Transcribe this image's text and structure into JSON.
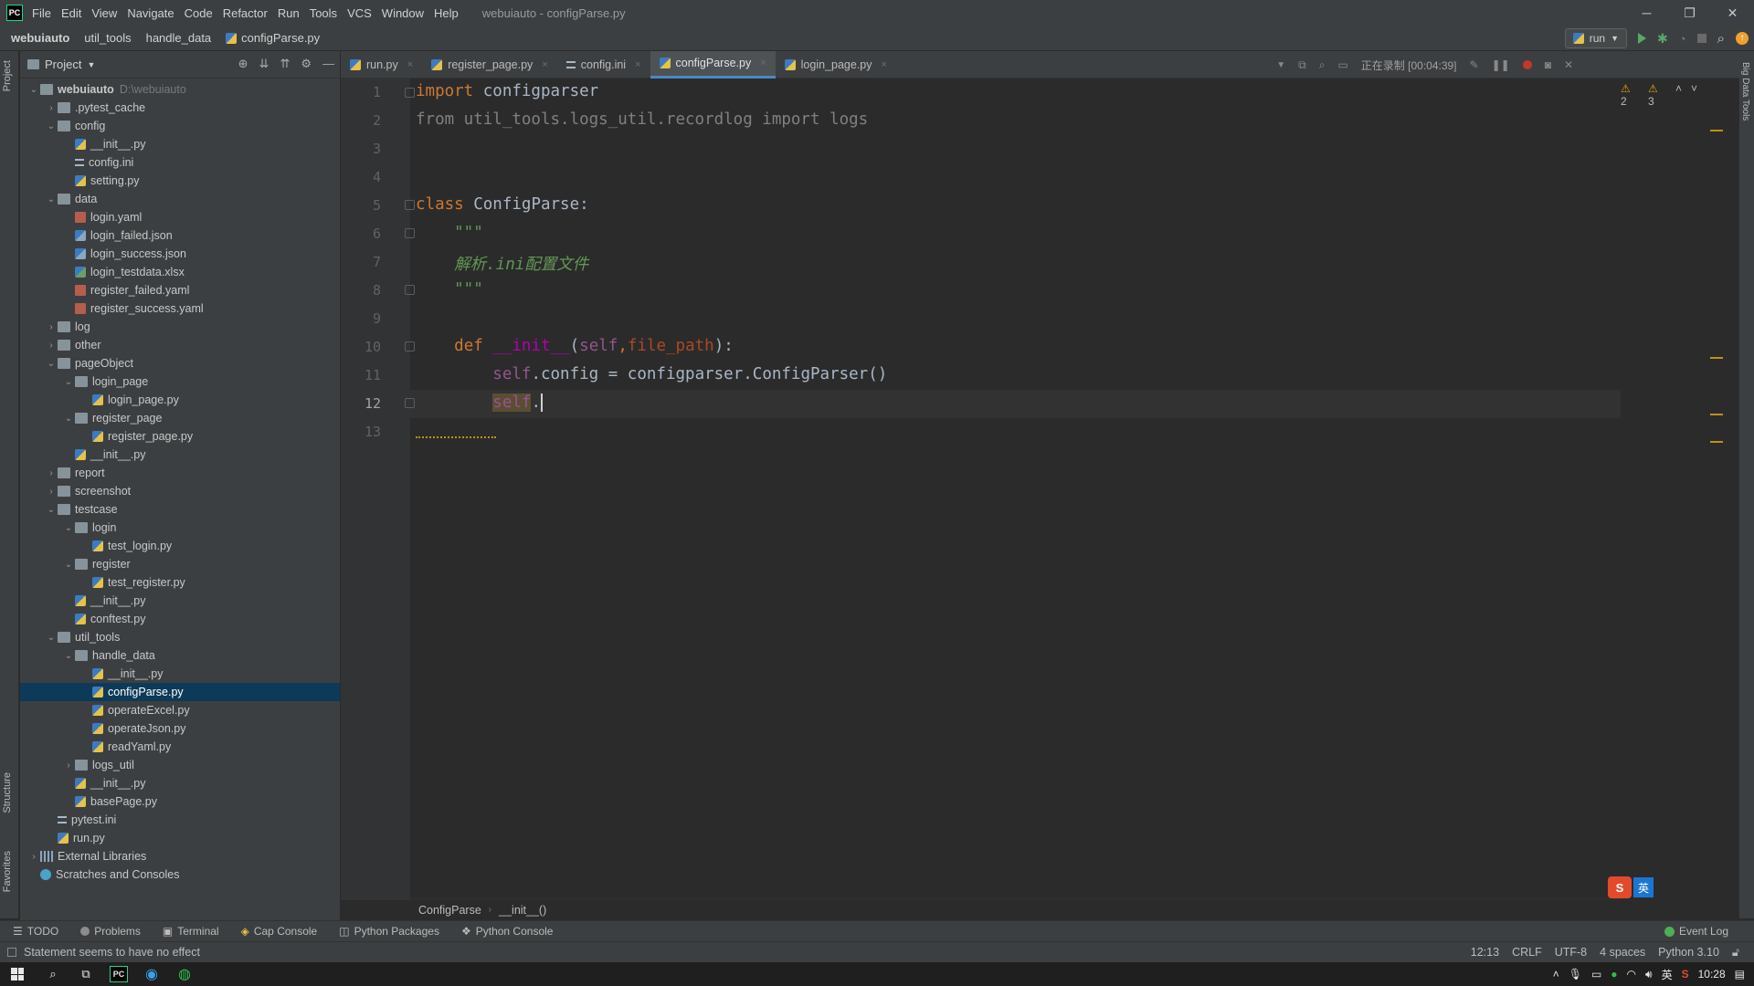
{
  "app": {
    "logo": "PC",
    "window_title": "webuiauto - configParse.py",
    "menu": [
      "File",
      "Edit",
      "View",
      "Navigate",
      "Code",
      "Refactor",
      "Run",
      "Tools",
      "VCS",
      "Window",
      "Help"
    ],
    "window_controls": [
      "─",
      "❐",
      "✕"
    ]
  },
  "navbar": {
    "crumbs": [
      "webuiauto",
      "util_tools",
      "handle_data",
      "configParse.py"
    ],
    "run_config": "run"
  },
  "left_strip": {
    "project": "Project",
    "structure": "Structure",
    "favorites": "Favorites"
  },
  "right_strip": {
    "bigdata": "Big Data Tools"
  },
  "project_panel": {
    "title": "Project",
    "tree": [
      {
        "label": "webuiauto",
        "hint": "D:\\webuiauto",
        "level": 0,
        "type": "folder",
        "open": true,
        "bold": true
      },
      {
        "label": ".pytest_cache",
        "level": 1,
        "type": "folder",
        "open": false
      },
      {
        "label": "config",
        "level": 1,
        "type": "folder",
        "open": true
      },
      {
        "label": "__init__.py",
        "level": 2,
        "type": "py"
      },
      {
        "label": "config.ini",
        "level": 2,
        "type": "ini"
      },
      {
        "label": "setting.py",
        "level": 2,
        "type": "py"
      },
      {
        "label": "data",
        "level": 1,
        "type": "folder",
        "open": true
      },
      {
        "label": "login.yaml",
        "level": 2,
        "type": "yaml"
      },
      {
        "label": "login_failed.json",
        "level": 2,
        "type": "json"
      },
      {
        "label": "login_success.json",
        "level": 2,
        "type": "json"
      },
      {
        "label": "login_testdata.xlsx",
        "level": 2,
        "type": "xlsx"
      },
      {
        "label": "register_failed.yaml",
        "level": 2,
        "type": "yaml"
      },
      {
        "label": "register_success.yaml",
        "level": 2,
        "type": "yaml"
      },
      {
        "label": "log",
        "level": 1,
        "type": "folder",
        "open": false
      },
      {
        "label": "other",
        "level": 1,
        "type": "folder",
        "open": false
      },
      {
        "label": "pageObject",
        "level": 1,
        "type": "folder",
        "open": true
      },
      {
        "label": "login_page",
        "level": 2,
        "type": "folder",
        "open": true
      },
      {
        "label": "login_page.py",
        "level": 3,
        "type": "py"
      },
      {
        "label": "register_page",
        "level": 2,
        "type": "folder",
        "open": true
      },
      {
        "label": "register_page.py",
        "level": 3,
        "type": "py"
      },
      {
        "label": "__init__.py",
        "level": 2,
        "type": "py"
      },
      {
        "label": "report",
        "level": 1,
        "type": "folder",
        "open": false
      },
      {
        "label": "screenshot",
        "level": 1,
        "type": "folder",
        "open": false
      },
      {
        "label": "testcase",
        "level": 1,
        "type": "folder",
        "open": true
      },
      {
        "label": "login",
        "level": 2,
        "type": "folder",
        "open": true
      },
      {
        "label": "test_login.py",
        "level": 3,
        "type": "py"
      },
      {
        "label": "register",
        "level": 2,
        "type": "folder",
        "open": true
      },
      {
        "label": "test_register.py",
        "level": 3,
        "type": "py"
      },
      {
        "label": "__init__.py",
        "level": 2,
        "type": "py"
      },
      {
        "label": "conftest.py",
        "level": 2,
        "type": "py"
      },
      {
        "label": "util_tools",
        "level": 1,
        "type": "folder",
        "open": true
      },
      {
        "label": "handle_data",
        "level": 2,
        "type": "folder",
        "open": true
      },
      {
        "label": "__init__.py",
        "level": 3,
        "type": "py"
      },
      {
        "label": "configParse.py",
        "level": 3,
        "type": "py",
        "selected": true
      },
      {
        "label": "operateExcel.py",
        "level": 3,
        "type": "py"
      },
      {
        "label": "operateJson.py",
        "level": 3,
        "type": "py"
      },
      {
        "label": "readYaml.py",
        "level": 3,
        "type": "py"
      },
      {
        "label": "logs_util",
        "level": 2,
        "type": "folder",
        "open": false
      },
      {
        "label": "__init__.py",
        "level": 2,
        "type": "py"
      },
      {
        "label": "basePage.py",
        "level": 2,
        "type": "py"
      },
      {
        "label": "pytest.ini",
        "level": 1,
        "type": "ini"
      },
      {
        "label": "run.py",
        "level": 1,
        "type": "py"
      },
      {
        "label": "External Libraries",
        "level": 0,
        "type": "lib",
        "open": false
      },
      {
        "label": "Scratches and Consoles",
        "level": 0,
        "type": "scratch"
      }
    ]
  },
  "tabs": [
    {
      "label": "run.py",
      "type": "py"
    },
    {
      "label": "register_page.py",
      "type": "py"
    },
    {
      "label": "config.ini",
      "type": "ini"
    },
    {
      "label": "configParse.py",
      "type": "py",
      "active": true
    },
    {
      "label": "login_page.py",
      "type": "py"
    }
  ],
  "recording": "正在录制 [00:04:39]",
  "inspections": {
    "warnings": "2",
    "weak_warnings": "3"
  },
  "editor": {
    "line_numbers": [
      "1",
      "2",
      "3",
      "4",
      "5",
      "6",
      "7",
      "8",
      "9",
      "10",
      "11",
      "12",
      "13"
    ],
    "current_line": "12",
    "lines": {
      "l1": {
        "kw": "import",
        "rest": " configparser"
      },
      "l2": {
        "text": "from util_tools.logs_util.recordlog import logs"
      },
      "l5": {
        "kw": "class",
        "rest": " ConfigParse:"
      },
      "l6": {
        "doc": "    \"\"\""
      },
      "l7": {
        "doc": "    解析.ini配置文件"
      },
      "l8": {
        "doc": "    \"\"\""
      },
      "l10": {
        "indent": "    ",
        "kw": "def",
        "sp": " ",
        "magic": "__init__",
        "open": "(",
        "self": "self",
        "comma": ",",
        "param": "file_path",
        "close": "):"
      },
      "l11": {
        "indent": "        ",
        "self": "self",
        "rest": ".config = configparser.ConfigParser()"
      },
      "l12": {
        "indent": "        ",
        "self": "self",
        "rest": "."
      }
    }
  },
  "editor_breadcrumb": [
    "ConfigParse",
    "__init__()"
  ],
  "tool_windows": [
    "TODO",
    "Problems",
    "Terminal",
    "Cap Console",
    "Python Packages",
    "Python Console"
  ],
  "event_log": "Event Log",
  "status": {
    "message": "Statement seems to have no effect",
    "position": "12:13",
    "line_sep": "CRLF",
    "encoding": "UTF-8",
    "indent": "4 spaces",
    "interpreter": "Python 3.10"
  },
  "ime": {
    "logo": "S",
    "lang": "英"
  },
  "taskbar": {
    "time": "10:28",
    "tray_lang": "英"
  }
}
